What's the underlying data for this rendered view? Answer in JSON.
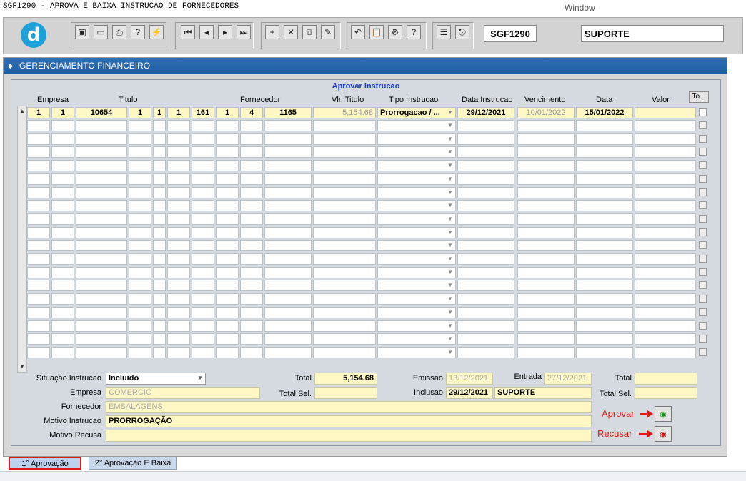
{
  "window": {
    "title": "SGF1290 - APROVA E BAIXA INSTRUCAO DE FORNECEDORES",
    "menu": "Window"
  },
  "toolbar": {
    "form_code": "SGF1290",
    "user": "SUPORTE"
  },
  "form": {
    "title": "GERENCIAMENTO FINANCEIRO",
    "frame_title": "Aprovar Instrucao"
  },
  "grid": {
    "headers": {
      "empresa": "Empresa",
      "titulo": "Titulo",
      "fornecedor": "Fornecedor",
      "vlr_titulo": "Vlr. Titulo",
      "tipo_instrucao": "Tipo Instrucao",
      "data_instrucao": "Data Instrucao",
      "vencimento": "Vencimento",
      "data": "Data",
      "valor": "Valor",
      "toggle": "To..."
    },
    "row": {
      "c1": "1",
      "c2": "1",
      "c3": "10654",
      "c4": "1",
      "c5": "1",
      "c6": "1",
      "c7": "161",
      "c8": "1",
      "c9": "4",
      "c10": "1165",
      "vlr_titulo": "5,154.68",
      "tipo_instrucao": "Prorrogacao / ...",
      "data_instrucao": "29/12/2021",
      "vencimento": "10/01/2022",
      "data": "15/01/2022",
      "valor": ""
    },
    "empty_rows": 18
  },
  "footer": {
    "situacao_label": "Situação Instrucao",
    "situacao_value": "Incluido",
    "total_label": "Total",
    "total_value": "5,154.68",
    "emissao_label": "Emissao",
    "emissao_value": "13/12/2021",
    "entrada_label": "Entrada",
    "entrada_value": "27/12/2021",
    "total2_label": "Total",
    "empresa_label": "Empresa",
    "empresa_value": "COMERCIO",
    "total_sel_label": "Total Sel.",
    "inclusao_label": "Inclusao",
    "inclusao_date": "29/12/2021",
    "inclusao_user": "SUPORTE",
    "total_sel2_label": "Total Sel.",
    "fornecedor_label": "Fornecedor",
    "fornecedor_value": "EMBALAGENS",
    "motivo_instrucao_label": "Motivo Instrucao",
    "motivo_instrucao_value": "PRORROGAÇÃO",
    "motivo_recusa_label": "Motivo Recusa",
    "motivo_recusa_value": ""
  },
  "actions": {
    "aprovar": "Aprovar",
    "recusar": "Recusar"
  },
  "tabs": [
    {
      "label": "1° Aprovação"
    },
    {
      "label": "2° Aprovação E Baixa"
    }
  ],
  "colors": {
    "accent": "#1f5ea3",
    "highlight": "#e01818",
    "field_yellow": "#fff8c4"
  }
}
